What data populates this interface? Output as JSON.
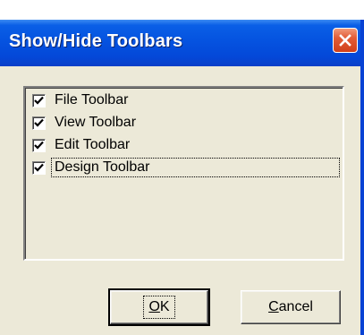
{
  "window": {
    "title": "Show/Hide Toolbars",
    "close_label": "Close"
  },
  "toolbars": {
    "items": [
      {
        "label": "File Toolbar",
        "checked": true
      },
      {
        "label": "View Toolbar",
        "checked": true
      },
      {
        "label": "Edit Toolbar",
        "checked": true
      },
      {
        "label": "Design Toolbar",
        "checked": true,
        "focused": true
      }
    ]
  },
  "buttons": {
    "ok": {
      "mnemonic": "O",
      "rest": "K"
    },
    "cancel": {
      "mnemonic": "C",
      "rest": "ancel"
    }
  },
  "colors": {
    "titlebar": "#0553e0",
    "dialog_bg": "#ece9d8",
    "close_button": "#e25c36"
  },
  "icons": {
    "close": "close-icon",
    "check": "checkmark-icon"
  }
}
